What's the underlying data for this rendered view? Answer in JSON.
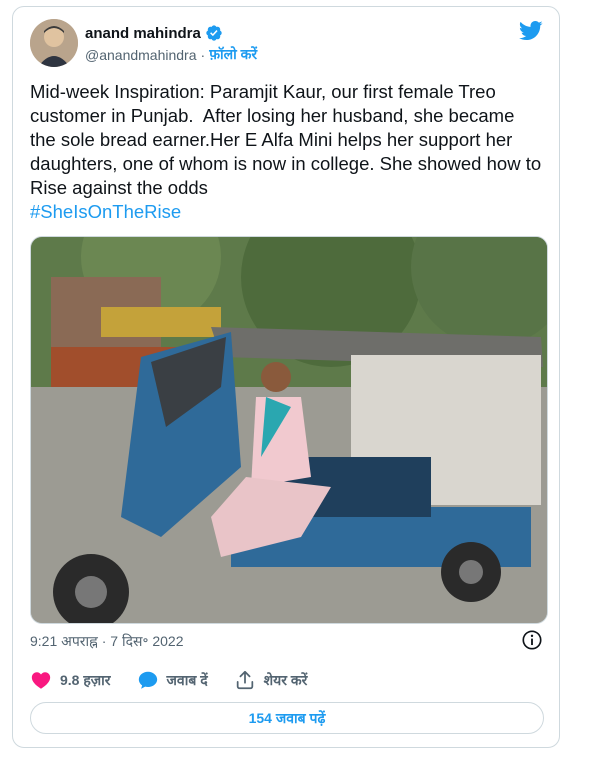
{
  "author": {
    "display_name": "anand mahindra",
    "handle": "@anandmahindra",
    "separator": "·",
    "follow_label": "फ़ॉलो करें"
  },
  "tweet": {
    "text": "Mid-week Inspiration: Paramjit Kaur, our first female Treo customer in Punjab.  After losing her husband, she became the sole bread earner.Her E Alfa Mini helps her support her daughters, one of whom is now in college. She showed how to Rise against the odds",
    "hashtag": "#SheIsOnTheRise",
    "timestamp": "9:21 अपराह्न · 7 दिस॰ 2022"
  },
  "actions": {
    "likes_label": "9.8 हज़ार",
    "reply_label": "जवाब दें",
    "share_label": "शेयर करें"
  },
  "replies_button_label": "154 जवाब पढ़ें",
  "colors": {
    "accent": "#1d9bf0",
    "like": "#f91880",
    "muted": "#536471",
    "border": "#cfd9de"
  },
  "icons": [
    "verified-badge-icon",
    "twitter-bird-icon",
    "info-icon",
    "heart-icon",
    "reply-bubble-icon",
    "share-icon"
  ]
}
